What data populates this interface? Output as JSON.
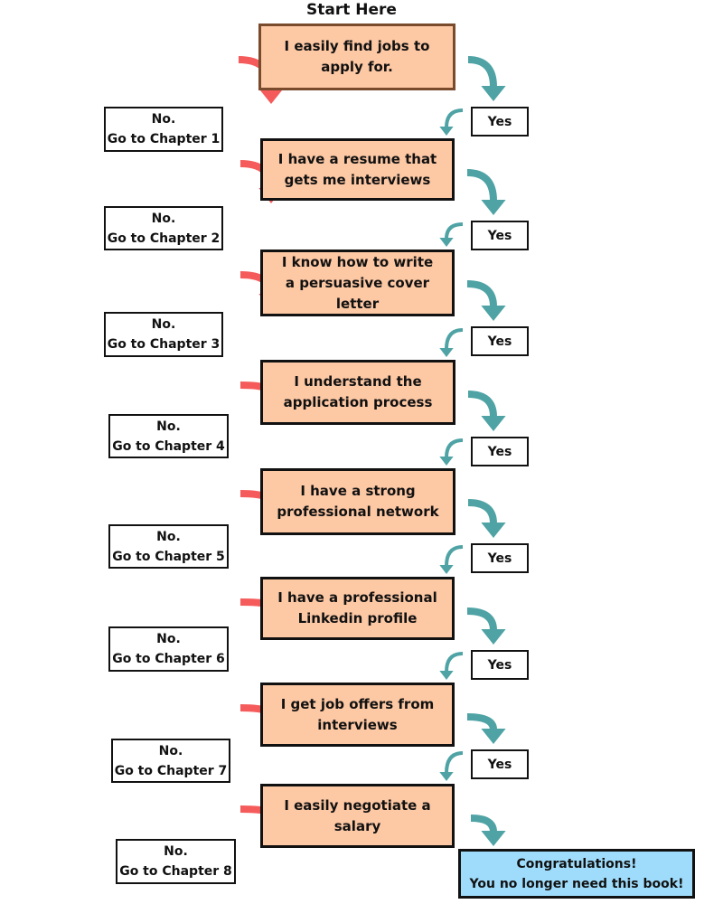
{
  "title": "Start Here",
  "colors": {
    "question_fill": "#fdc8a4",
    "no_arrow": "#f55b5b",
    "yes_arrow": "#4fa3a5",
    "result_fill": "#9fdcfb"
  },
  "questions": [
    {
      "text": "I easily find jobs to apply for.",
      "no": "No.\nGo to Chapter 1",
      "yes": "Yes"
    },
    {
      "text": "I have a resume that gets me interviews",
      "no": "No.\nGo to Chapter 2",
      "yes": "Yes"
    },
    {
      "text": "I know how to write a persuasive cover letter",
      "no": "No.\nGo to Chapter 3",
      "yes": "Yes"
    },
    {
      "text": "I understand the application process",
      "no": "No.\nGo to Chapter 4",
      "yes": "Yes"
    },
    {
      "text": "I have a strong professional network",
      "no": "No.\nGo to Chapter 5",
      "yes": "Yes"
    },
    {
      "text": "I have a professional Linkedin profile",
      "no": "No.\nGo to Chapter 6",
      "yes": "Yes"
    },
    {
      "text": "I get job offers from interviews",
      "no": "No.\nGo to Chapter 7",
      "yes": "Yes"
    },
    {
      "text": "I easily negotiate a salary",
      "no": "No.\nGo to Chapter 8",
      "yes": null
    }
  ],
  "result": "Congratulations!\nYou no longer need this book!"
}
